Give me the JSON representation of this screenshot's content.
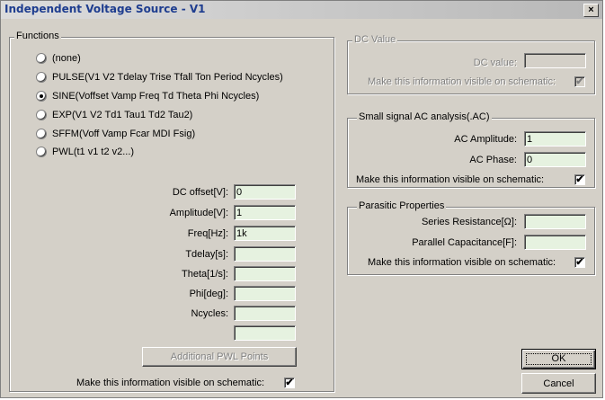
{
  "window": {
    "title": "Independent Voltage Source - V1",
    "close_label": "×"
  },
  "functions": {
    "legend": "Functions",
    "options": [
      {
        "label": "(none)",
        "selected": false
      },
      {
        "label": "PULSE(V1 V2 Tdelay Trise Tfall Ton Period Ncycles)",
        "selected": false
      },
      {
        "label": "SINE(Voffset Vamp Freq Td Theta Phi Ncycles)",
        "selected": true
      },
      {
        "label": "EXP(V1 V2 Td1 Tau1 Td2 Tau2)",
        "selected": false
      },
      {
        "label": "SFFM(Voff Vamp Fcar MDI Fsig)",
        "selected": false
      },
      {
        "label": "PWL(t1 v1 t2 v2...)",
        "selected": false
      }
    ],
    "params": [
      {
        "label": "DC offset[V]:",
        "value": "0"
      },
      {
        "label": "Amplitude[V]:",
        "value": "1"
      },
      {
        "label": "Freq[Hz]:",
        "value": "1k"
      },
      {
        "label": "Tdelay[s]:",
        "value": ""
      },
      {
        "label": "Theta[1/s]:",
        "value": ""
      },
      {
        "label": "Phi[deg]:",
        "value": ""
      },
      {
        "label": "Ncycles:",
        "value": ""
      },
      {
        "label": "",
        "value": ""
      }
    ],
    "pwl_button": "Additional PWL Points",
    "visible_label": "Make this information visible on schematic:",
    "visible_checked": "✔"
  },
  "dc": {
    "legend": "DC Value",
    "value_label": "DC value:",
    "value": "",
    "visible_label": "Make this information visible on schematic:",
    "visible_checked": "✔"
  },
  "ac": {
    "legend": "Small signal AC analysis(.AC)",
    "amplitude_label": "AC Amplitude:",
    "amplitude": "1",
    "phase_label": "AC Phase:",
    "phase": "0",
    "visible_label": "Make this information visible on schematic:",
    "visible_checked": "✔"
  },
  "parasitic": {
    "legend": "Parasitic Properties",
    "resistance_label": "Series Resistance[Ω]:",
    "resistance": "",
    "capacitance_label": "Parallel Capacitance[F]:",
    "capacitance": "",
    "visible_label": "Make this information visible on schematic:",
    "visible_checked": "✔"
  },
  "buttons": {
    "ok": "OK",
    "cancel": "Cancel"
  }
}
